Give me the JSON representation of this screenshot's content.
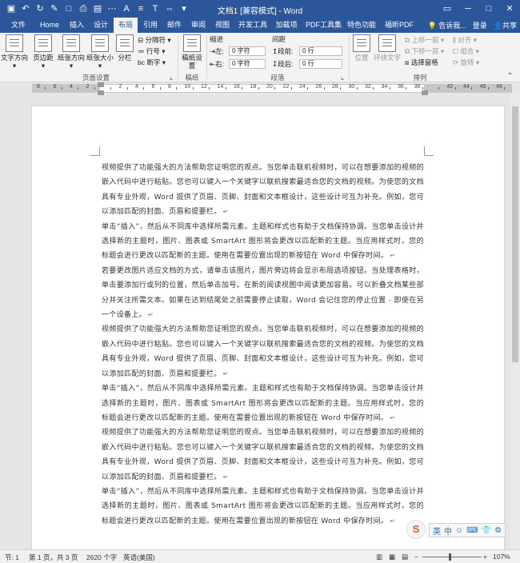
{
  "window": {
    "title": "文档1 [兼容模式] - Word",
    "quick_access": [
      "save-icon",
      "undo-icon",
      "redo-icon",
      "format-painter-icon",
      "new-doc-icon",
      "print-icon",
      "layout-icon",
      "more-icon",
      "font-color-icon",
      "align-icon",
      "text-icon",
      "spacing-icon",
      "customize-icon"
    ]
  },
  "tabs": [
    "文件",
    "Home",
    "插入",
    "设计",
    "布局",
    "引用",
    "邮件",
    "审阅",
    "视图",
    "开发工具",
    "加载项",
    "PDF工具集",
    "特色功能",
    "福昕PDF"
  ],
  "active_tab": "布局",
  "tell_me": "告诉我...",
  "login": "登录",
  "share": "共享",
  "ribbon": {
    "page_setup": {
      "text_direction": "文字方向",
      "margins": "页边距",
      "orientation": "纸张方向",
      "size": "纸张大小",
      "columns": "分栏",
      "breaks": "分隔符",
      "line_numbers": "行号",
      "hyphenation": "断字",
      "group_label": "页面设置"
    },
    "draft": {
      "label": "稿纸设置",
      "group_label": "稿纸"
    },
    "paragraph": {
      "indent_label": "缩进",
      "spacing_label": "间距",
      "left_label": "左:",
      "left_value": "0 字符",
      "right_label": "右:",
      "right_value": "0 字符",
      "before_label": "段前:",
      "before_value": "0 行",
      "after_label": "段后:",
      "after_value": "0 行",
      "group_label": "段落"
    },
    "arrange": {
      "position": "位置",
      "wrap_text": "环绕文字",
      "bring_forward": "上移一层",
      "send_backward": "下移一层",
      "selection_pane": "选择窗格",
      "align": "对齐",
      "group": "组合",
      "rotate": "旋转",
      "group_label": "排列"
    }
  },
  "ruler": {
    "numbers": [
      "8",
      "6",
      "4",
      "2",
      "",
      "2",
      "4",
      "6",
      "8",
      "10",
      "12",
      "14",
      "16",
      "18",
      "20",
      "22",
      "24",
      "26",
      "28",
      "30",
      "32",
      "34",
      "36",
      "38",
      "",
      "42",
      "44",
      "46",
      "48"
    ]
  },
  "document": {
    "paragraphs": [
      "视频提供了功能强大的方法帮助您证明您的观点。当您单击联机视频时，可以在想要添加的视频的嵌入代码中进行粘贴。您也可以键入一个关键字以联机搜索最适合您的文档的视频。为使您的文档具有专业外观，Word 提供了页眉、页脚、封面和文本框设计，这些设计可互为补充。例如，您可以添加匹配的封面、页眉和提要栏。",
      "单击“插入”，然后从不同库中选择所需元素。主题和样式也有助于文档保持协调。当您单击设计并选择新的主题时，图片、图表或 SmartArt 图形将会更改以匹配新的主题。当应用样式时，您的标题会进行更改以匹配新的主题。使用在需要位置出现的新按钮在 Word 中保存时间。",
      "若要更改图片适应文档的方式，请单击该图片，图片旁边将会显示布局选项按钮。当处理表格时，单击要添加行或列的位置，然后单击加号。在新的阅读视图中阅读更加容易。可以折叠文档某些部分并关注所需文本。如果在达到结尾处之前需要停止读取，Word 会记住您的停止位置 - 即使在另一个设备上。",
      "视频提供了功能强大的方法帮助您证明您的观点。当您单击联机视频时，可以在想要添加的视频的嵌入代码中进行粘贴。您也可以键入一个关键字以联机搜索最适合您的文档的视频。为使您的文档具有专业外观，Word 提供了页眉、页脚、封面和文本框设计，这些设计可互为补充。例如，您可以添加匹配的封面、页眉和提要栏。",
      "单击“插入”，然后从不同库中选择所需元素。主题和样式也有助于文档保持协调。当您单击设计并选择新的主题时，图片、图表或 SmartArt 图形将会更改以匹配新的主题。当应用样式时，您的标题会进行更改以匹配新的主题。使用在需要位置出现的新按钮在 Word 中保存时间。",
      "视频提供了功能强大的方法帮助您证明您的观点。当您单击联机视频时，可以在想要添加的视频的嵌入代码中进行粘贴。您也可以键入一个关键字以联机搜索最适合您的文档的视频。为使您的文档具有专业外观，Word 提供了页眉、页脚、封面和文本框设计，这些设计可互为补充。例如，您可以添加匹配的封面、页眉和提要栏。",
      "单击“插入”，然后从不同库中选择所需元素。主题和样式也有助于文档保持协调。当您单击设计并选择新的主题时，图片、图表或 SmartArt 图形将会更改以匹配新的主题。当应用样式时，您的标题会进行更改以匹配新的主题。使用在需要位置出现的新按钮在 Word 中保存时间。"
    ],
    "paragraph_mark": "↵"
  },
  "ime_bar": {
    "label": "英",
    "items": [
      "中",
      "☺",
      "⌨",
      "👕",
      "⚙"
    ]
  },
  "status": {
    "section": "节: 1",
    "page": "第 1 页，共 3 页",
    "words": "2620 个字",
    "language": "英语(美国)",
    "zoom": "107%"
  },
  "colors": {
    "accent": "#2b579a",
    "ribbon_bg": "#f3f3f3",
    "canvas": "#e6e6e6"
  }
}
